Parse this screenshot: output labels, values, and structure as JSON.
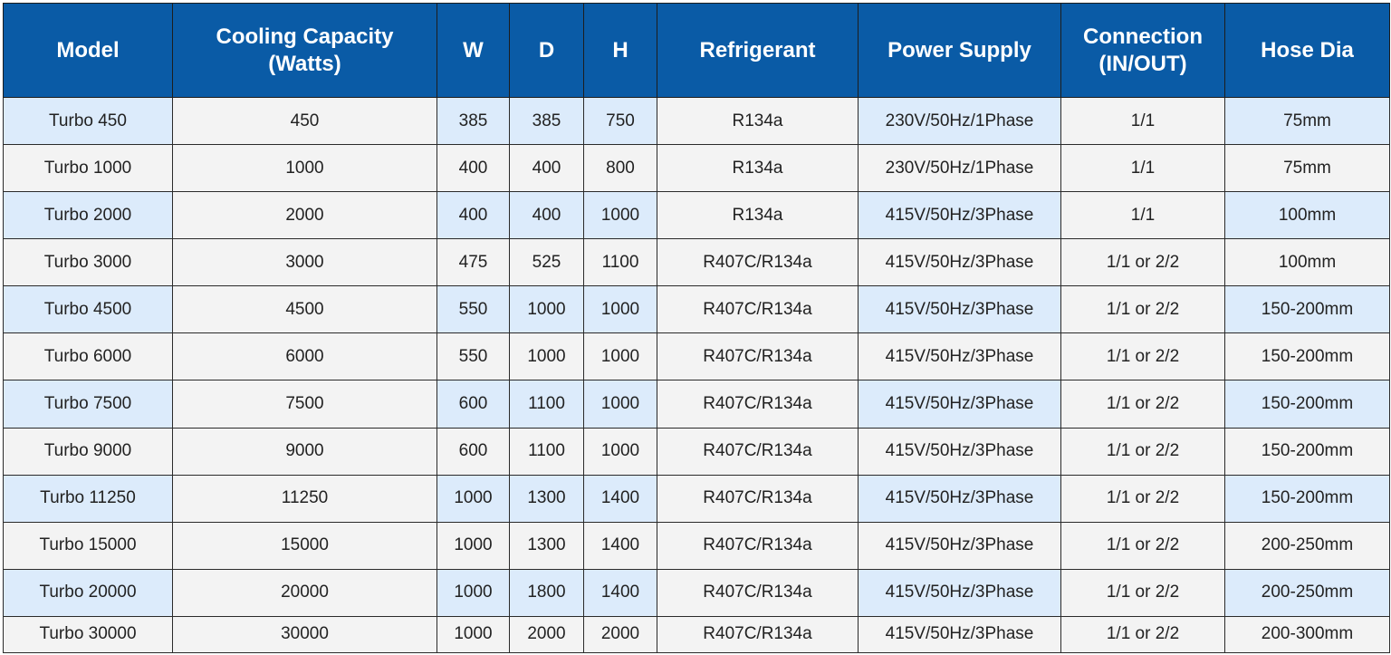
{
  "table": {
    "headers": [
      {
        "key": "model",
        "lines": [
          "Model"
        ]
      },
      {
        "key": "cooling",
        "lines": [
          "Cooling Capacity",
          "(Watts)"
        ]
      },
      {
        "key": "w",
        "lines": [
          "W"
        ]
      },
      {
        "key": "d",
        "lines": [
          "D"
        ]
      },
      {
        "key": "h",
        "lines": [
          "H"
        ]
      },
      {
        "key": "refrigerant",
        "lines": [
          "Refrigerant"
        ]
      },
      {
        "key": "power",
        "lines": [
          "Power Supply"
        ]
      },
      {
        "key": "connection",
        "lines": [
          "Connection",
          "(IN/OUT)"
        ]
      },
      {
        "key": "hose",
        "lines": [
          "Hose Dia"
        ]
      }
    ],
    "rows": [
      [
        "Turbo 450",
        "450",
        "385",
        "385",
        "750",
        "R134a",
        "230V/50Hz/1Phase",
        "1/1",
        "75mm"
      ],
      [
        "Turbo 1000",
        "1000",
        "400",
        "400",
        "800",
        "R134a",
        "230V/50Hz/1Phase",
        "1/1",
        "75mm"
      ],
      [
        "Turbo 2000",
        "2000",
        "400",
        "400",
        "1000",
        "R134a",
        "415V/50Hz/3Phase",
        "1/1",
        "100mm"
      ],
      [
        "Turbo 3000",
        "3000",
        "475",
        "525",
        "1100",
        "R407C/R134a",
        "415V/50Hz/3Phase",
        "1/1 or 2/2",
        "100mm"
      ],
      [
        "Turbo 4500",
        "4500",
        "550",
        "1000",
        "1000",
        "R407C/R134a",
        "415V/50Hz/3Phase",
        "1/1 or 2/2",
        "150-200mm"
      ],
      [
        "Turbo 6000",
        "6000",
        "550",
        "1000",
        "1000",
        "R407C/R134a",
        "415V/50Hz/3Phase",
        "1/1 or 2/2",
        "150-200mm"
      ],
      [
        "Turbo 7500",
        "7500",
        "600",
        "1100",
        "1000",
        "R407C/R134a",
        "415V/50Hz/3Phase",
        "1/1 or 2/2",
        "150-200mm"
      ],
      [
        "Turbo 9000",
        "9000",
        "600",
        "1100",
        "1000",
        "R407C/R134a",
        "415V/50Hz/3Phase",
        "1/1 or 2/2",
        "150-200mm"
      ],
      [
        "Turbo 11250",
        "11250",
        "1000",
        "1300",
        "1400",
        "R407C/R134a",
        "415V/50Hz/3Phase",
        "1/1 or 2/2",
        "150-200mm"
      ],
      [
        "Turbo 15000",
        "15000",
        "1000",
        "1300",
        "1400",
        "R407C/R134a",
        "415V/50Hz/3Phase",
        "1/1 or 2/2",
        "200-250mm"
      ],
      [
        "Turbo 20000",
        "20000",
        "1000",
        "1800",
        "1400",
        "R407C/R134a",
        "415V/50Hz/3Phase",
        "1/1 or 2/2",
        "200-250mm"
      ],
      [
        "Turbo 30000",
        "30000",
        "1000",
        "2000",
        "2000",
        "R407C/R134a",
        "415V/50Hz/3Phase",
        "1/1 or 2/2",
        "200-300mm"
      ]
    ]
  },
  "colors": {
    "header_bg": "#0a5ba6",
    "header_text": "#ffffff",
    "row_shade": "#dcebfb",
    "row_plain": "#f3f3f3",
    "border": "#2a2a2a"
  }
}
